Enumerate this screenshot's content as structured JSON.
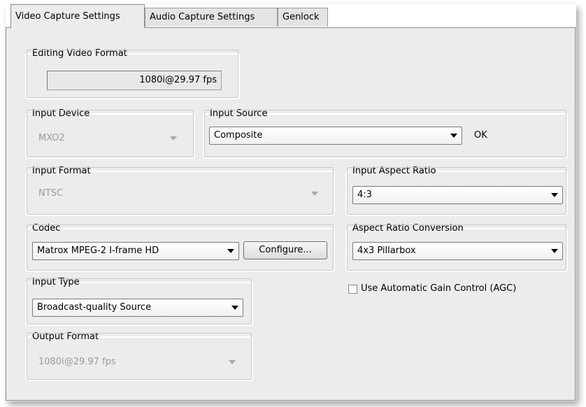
{
  "tabs": [
    {
      "label": "Video Capture Settings",
      "active": true
    },
    {
      "label": "Audio Capture Settings",
      "active": false
    },
    {
      "label": "Genlock",
      "active": false
    }
  ],
  "editing_video_format": {
    "legend": "Editing Video Format",
    "value": "1080i@29.97 fps"
  },
  "input_device": {
    "legend": "Input Device",
    "value": "MXO2",
    "enabled": false
  },
  "input_source": {
    "legend": "Input Source",
    "value": "Composite",
    "status": "OK"
  },
  "input_format": {
    "legend": "Input Format",
    "value": "NTSC",
    "enabled": false
  },
  "input_aspect_ratio": {
    "legend": "Input Aspect Ratio",
    "value": "4:3"
  },
  "codec": {
    "legend": "Codec",
    "value": "Matrox MPEG-2 I-frame HD",
    "button_label": "Configure..."
  },
  "aspect_ratio_conversion": {
    "legend": "Aspect Ratio Conversion",
    "value": "4x3 Pillarbox"
  },
  "input_type": {
    "legend": "Input Type",
    "value": "Broadcast-quality Source"
  },
  "agc": {
    "label": "Use Automatic Gain Control (AGC)",
    "checked": false
  },
  "output_format": {
    "legend": "Output Format",
    "value": "1080i@29.97 fps",
    "enabled": false
  }
}
